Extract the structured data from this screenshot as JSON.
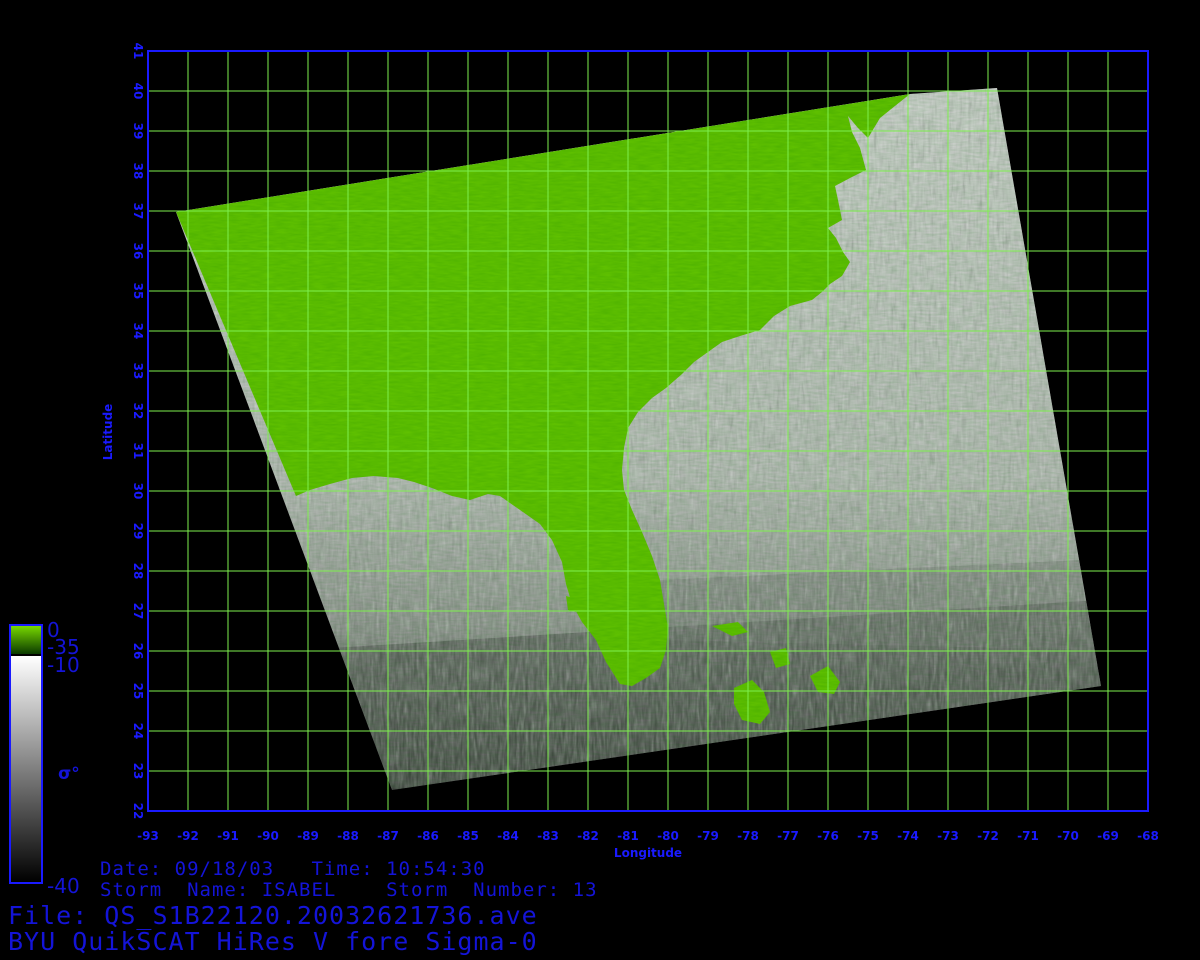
{
  "axes": {
    "x_label": "Longitude",
    "y_label": "Latitude",
    "x_ticks": [
      "-93",
      "-92",
      "-91",
      "-90",
      "-89",
      "-88",
      "-87",
      "-86",
      "-85",
      "-84",
      "-83",
      "-82",
      "-81",
      "-80",
      "-79",
      "-78",
      "-77",
      "-76",
      "-75",
      "-74",
      "-73",
      "-72",
      "-71",
      "-70",
      "-69",
      "-68"
    ],
    "y_ticks": [
      "22",
      "23",
      "24",
      "25",
      "26",
      "27",
      "28",
      "29",
      "30",
      "31",
      "32",
      "33",
      "34",
      "35",
      "36",
      "37",
      "38",
      "39",
      "40",
      "41"
    ],
    "x_range": [
      -93,
      -68
    ],
    "y_range": [
      22,
      41
    ],
    "grid": true
  },
  "colorbar": {
    "labels": [
      "0",
      "-35",
      "-10",
      "-40"
    ],
    "symbol": "σ°"
  },
  "colors": {
    "axis": "#1a1aff",
    "grid": "#7ef04e",
    "land": "#63c400",
    "text": "#1414d8"
  },
  "info": {
    "date_time": "Date: 09/18/03   Time: 10:54:30",
    "storm": "Storm  Name: ISABEL    Storm  Number: 13",
    "file": "File: QS_S1B22120.20032621736.ave",
    "title": "BYU QuikSCAT HiRes V fore Sigma-0"
  }
}
